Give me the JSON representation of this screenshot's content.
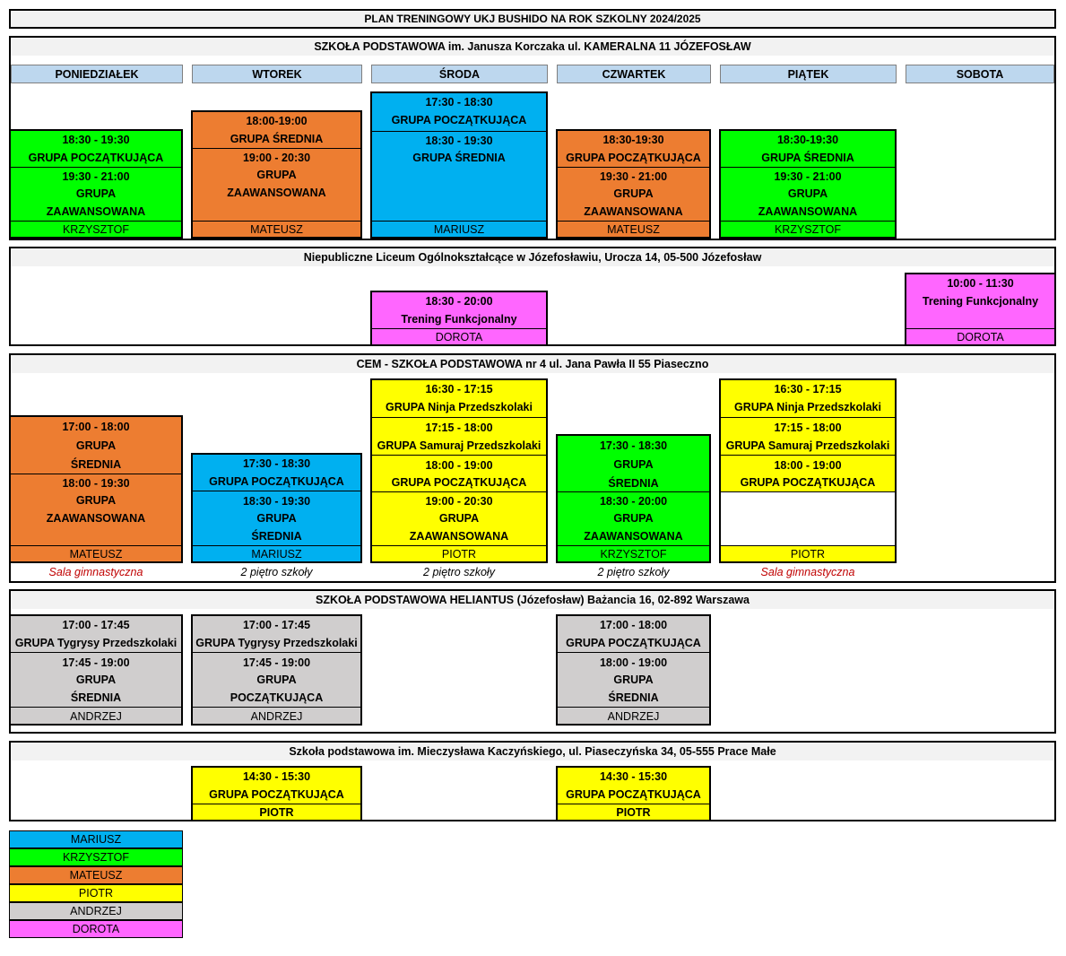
{
  "title": "PLAN TRENINGOWY UKJ BUSHIDO NA ROK SZKOLNY 2024/2025",
  "days": [
    "PONIEDZIAŁEK",
    "WTOREK",
    "ŚRODA",
    "CZWARTEK",
    "PIĄTEK",
    "SOBOTA"
  ],
  "colors": {
    "blue": "#00b0f0",
    "green": "#00ff00",
    "orange": "#ed7d31",
    "yellow": "#ffff00",
    "gray": "#d0cece",
    "pink": "#ff66ff",
    "header_blue": "#bdd7ee"
  },
  "s1": {
    "name": "SZKOŁA PODSTAWOWA im. Janusza Korczaka ul. KAMERALNA 11 JÓZEFOSŁAW",
    "mon": [
      "18:30 - 19:30",
      "GRUPA POCZĄTKUJĄCA",
      "19:30 - 21:00",
      "GRUPA",
      "ZAAWANSOWANA",
      "KRZYSZTOF"
    ],
    "tue": [
      "18:00-19:00",
      "GRUPA ŚREDNIA",
      "19:00 - 20:30",
      "GRUPA",
      "ZAAWANSOWANA",
      "MATEUSZ"
    ],
    "wed": [
      "17:30 - 18:30",
      "GRUPA POCZĄTKUJĄCA",
      "18:30 - 19:30",
      "GRUPA ŚREDNIA",
      "MARIUSZ"
    ],
    "thu": [
      "18:30-19:30",
      "GRUPA POCZĄTKUJĄCA",
      "19:30 - 21:00",
      "GRUPA",
      "ZAAWANSOWANA",
      "MATEUSZ"
    ],
    "fri": [
      "18:30-19:30",
      "GRUPA ŚREDNIA",
      "19:30 - 21:00",
      "GRUPA",
      "ZAAWANSOWANA",
      "KRZYSZTOF"
    ]
  },
  "s2": {
    "name": "Niepubliczne Liceum Ogólnokształcące w Józefosławiu, Urocza 14, 05-500 Józefosław",
    "wed": [
      "18:30 - 20:00",
      "Trening Funkcjonalny",
      "DOROTA"
    ],
    "sat": [
      "10:00 - 11:30",
      "Trening Funkcjonalny",
      "DOROTA"
    ]
  },
  "s3": {
    "name": "CEM - SZKOŁA PODSTAWOWA nr 4 ul. Jana Pawła II 55 Piaseczno",
    "mon": [
      "17:00 - 18:00",
      "GRUPA",
      "ŚREDNIA",
      "18:00 - 19:30",
      "GRUPA",
      "ZAAWANSOWANA",
      "MATEUSZ"
    ],
    "tue": [
      "17:30 - 18:30",
      "GRUPA POCZĄTKUJĄCA",
      "18:30 - 19:30",
      "GRUPA",
      "ŚREDNIA",
      "MARIUSZ"
    ],
    "wed": [
      "16:30 - 17:15",
      "GRUPA Ninja Przedszkolaki",
      "17:15 - 18:00",
      "GRUPA Samuraj Przedszkolaki",
      "18:00 - 19:00",
      "GRUPA POCZĄTKUJĄCA",
      "19:00 - 20:30",
      "GRUPA",
      "ZAAWANSOWANA",
      "PIOTR"
    ],
    "thu": [
      "17:30 - 18:30",
      "GRUPA",
      "ŚREDNIA",
      "18:30 - 20:00",
      "GRUPA",
      "ZAAWANSOWANA",
      "KRZYSZTOF"
    ],
    "fri": [
      "16:30 - 17:15",
      "GRUPA Ninja Przedszkolaki",
      "17:15 - 18:00",
      "GRUPA Samuraj Przedszkolaki",
      "18:00 - 19:00",
      "GRUPA POCZĄTKUJĄCA",
      "PIOTR"
    ],
    "notes": [
      "Sala gimnastyczna",
      "2 piętro szkoły",
      "2 piętro szkoły",
      "2 piętro szkoły",
      "Sala gimnastyczna"
    ]
  },
  "s4": {
    "name": "SZKOŁA PODSTAWOWA HELIANTUS (Józefosław) Bażancia 16, 02-892 Warszawa",
    "mon": [
      "17:00 - 17:45",
      "GRUPA Tygrysy Przedszkolaki",
      "17:45 - 19:00",
      "GRUPA",
      "ŚREDNIA",
      "ANDRZEJ"
    ],
    "tue": [
      "17:00 - 17:45",
      "GRUPA Tygrysy Przedszkolaki",
      "17:45 - 19:00",
      "GRUPA",
      "POCZĄTKUJĄCA",
      "ANDRZEJ"
    ],
    "thu": [
      "17:00 - 18:00",
      "GRUPA POCZĄTKUJĄCA",
      "18:00 - 19:00",
      "GRUPA",
      "ŚREDNIA",
      "ANDRZEJ"
    ]
  },
  "s5": {
    "name": "Szkoła podstawowa im. Mieczysława Kaczyńskiego, ul. Piaseczyńska 34, 05-555 Prace Małe",
    "tue": [
      "14:30 - 15:30",
      "GRUPA POCZĄTKUJĄCA",
      "PIOTR"
    ],
    "thu": [
      "14:30 - 15:30",
      "GRUPA POCZĄTKUJĄCA",
      "PIOTR"
    ]
  },
  "legend": [
    "MARIUSZ",
    "KRZYSZTOF",
    "MATEUSZ",
    "PIOTR",
    "ANDRZEJ",
    "DOROTA"
  ]
}
